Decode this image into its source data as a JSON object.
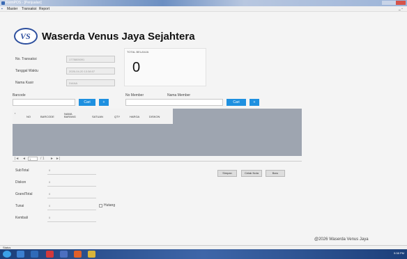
{
  "window": {
    "title": "FormPOS - [Penjualan]"
  },
  "menu": {
    "items": [
      "Master",
      "Transaksi",
      "Report"
    ]
  },
  "header": {
    "logo_text": "VS",
    "company_name": "Waserda Venus Jaya Sejahtera"
  },
  "transaction": {
    "no_transaksi_label": "No. Transaksi",
    "no_transaksi_value": "1778805091",
    "tanggal_label": "Tanggal Waktu",
    "tanggal_value": "2026-04-20 13:38:07",
    "kasir_label": "Nama Kasir",
    "kasir_value": "DIANA"
  },
  "total": {
    "label": "TOTAL BELANJA",
    "value": "0"
  },
  "barcode": {
    "label": "Barcode",
    "search_button": "Cari",
    "add_button": "+"
  },
  "member": {
    "no_label": "No Member",
    "name_label": "Nama Member",
    "search_button": "Cari",
    "add_button": "+"
  },
  "grid": {
    "columns": [
      "NO",
      "BARCODE",
      "NAMA BARANG",
      "SATUAN",
      "QTY",
      "HARGA",
      "DISKON"
    ]
  },
  "pager": {
    "first": "|◄",
    "prev": "◄",
    "page": "1",
    "of": "/ 1",
    "next": "►",
    "last": "►|"
  },
  "summary": {
    "subtotal_label": "SubTotal",
    "subtotal_value": "0",
    "diskon_label": "Diskon",
    "diskon_value": "0",
    "grandtotal_label": "GrandTotal",
    "grandtotal_value": "0",
    "tunai_label": "Tunai",
    "tunai_value": "0",
    "hutang_label": "Hutang",
    "kembali_label": "Kembali",
    "kembali_value": "0"
  },
  "actions": {
    "simpan": "Simpan",
    "cetak_nota": "Cetak Nota",
    "baru": "Baru"
  },
  "footer": {
    "copyright": "@2026 Waserda Venus Jaya"
  },
  "status": {
    "text": "Status"
  },
  "taskbar": {
    "clock": "5:38 PM"
  },
  "colors": {
    "accent": "#1e90e0",
    "grid_background": "#9ea5b0",
    "taskbar": "#1c3f7a"
  }
}
